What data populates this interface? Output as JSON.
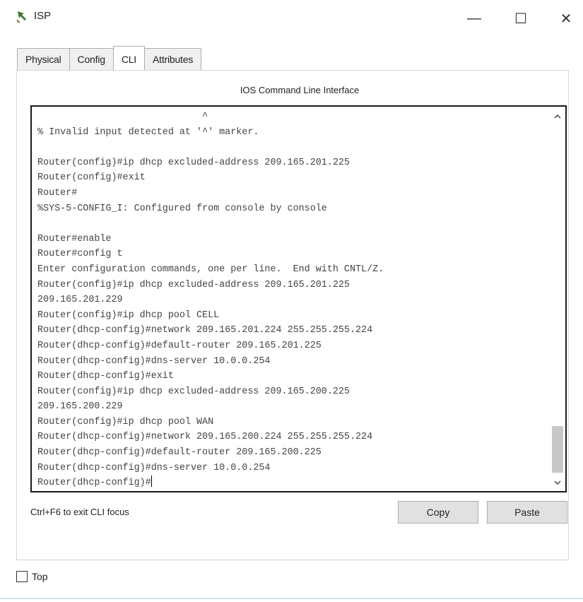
{
  "window": {
    "title": "ISP",
    "icon": "router-icon",
    "controls": {
      "minimize": "—",
      "maximize": "☐",
      "close": "✕"
    }
  },
  "tabs": [
    {
      "label": "Physical",
      "active": false
    },
    {
      "label": "Config",
      "active": false
    },
    {
      "label": "CLI",
      "active": true
    },
    {
      "label": "Attributes",
      "active": false
    }
  ],
  "cli": {
    "header": "IOS Command Line Interface",
    "console_lines": [
      "                             ^",
      "% Invalid input detected at '^' marker.",
      "",
      "Router(config)#ip dhcp excluded-address 209.165.201.225",
      "Router(config)#exit",
      "Router#",
      "%SYS-5-CONFIG_I: Configured from console by console",
      "",
      "Router#enable",
      "Router#config t",
      "Enter configuration commands, one per line.  End with CNTL/Z.",
      "Router(config)#ip dhcp excluded-address 209.165.201.225",
      "209.165.201.229",
      "Router(config)#ip dhcp pool CELL",
      "Router(dhcp-config)#network 209.165.201.224 255.255.255.224",
      "Router(dhcp-config)#default-router 209.165.201.225",
      "Router(dhcp-config)#dns-server 10.0.0.254",
      "Router(dhcp-config)#exit",
      "Router(config)#ip dhcp excluded-address 209.165.200.225",
      "209.165.200.229",
      "Router(config)#ip dhcp pool WAN",
      "Router(dhcp-config)#network 209.165.200.224 255.255.255.224",
      "Router(dhcp-config)#default-router 209.165.200.225",
      "Router(dhcp-config)#dns-server 10.0.0.254",
      "Router(dhcp-config)#"
    ],
    "focus_hint": "Ctrl+F6 to exit CLI focus",
    "copy_label": "Copy",
    "paste_label": "Paste"
  },
  "top_checkbox": {
    "label": "Top",
    "checked": false
  }
}
